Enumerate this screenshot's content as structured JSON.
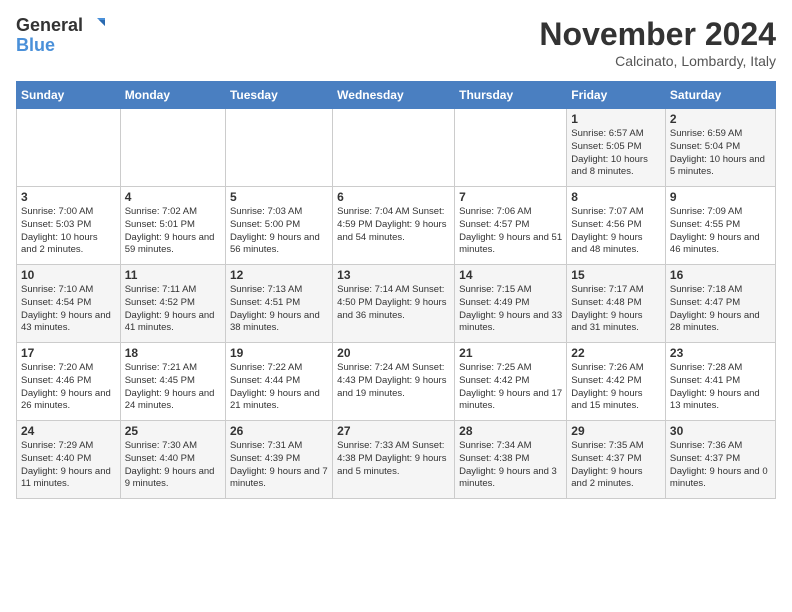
{
  "logo": {
    "line1": "General",
    "line2": "Blue"
  },
  "title": "November 2024",
  "location": "Calcinato, Lombardy, Italy",
  "weekdays": [
    "Sunday",
    "Monday",
    "Tuesday",
    "Wednesday",
    "Thursday",
    "Friday",
    "Saturday"
  ],
  "weeks": [
    [
      {
        "day": "",
        "info": ""
      },
      {
        "day": "",
        "info": ""
      },
      {
        "day": "",
        "info": ""
      },
      {
        "day": "",
        "info": ""
      },
      {
        "day": "",
        "info": ""
      },
      {
        "day": "1",
        "info": "Sunrise: 6:57 AM\nSunset: 5:05 PM\nDaylight: 10 hours\nand 8 minutes."
      },
      {
        "day": "2",
        "info": "Sunrise: 6:59 AM\nSunset: 5:04 PM\nDaylight: 10 hours\nand 5 minutes."
      }
    ],
    [
      {
        "day": "3",
        "info": "Sunrise: 7:00 AM\nSunset: 5:03 PM\nDaylight: 10 hours\nand 2 minutes."
      },
      {
        "day": "4",
        "info": "Sunrise: 7:02 AM\nSunset: 5:01 PM\nDaylight: 9 hours\nand 59 minutes."
      },
      {
        "day": "5",
        "info": "Sunrise: 7:03 AM\nSunset: 5:00 PM\nDaylight: 9 hours\nand 56 minutes."
      },
      {
        "day": "6",
        "info": "Sunrise: 7:04 AM\nSunset: 4:59 PM\nDaylight: 9 hours\nand 54 minutes."
      },
      {
        "day": "7",
        "info": "Sunrise: 7:06 AM\nSunset: 4:57 PM\nDaylight: 9 hours\nand 51 minutes."
      },
      {
        "day": "8",
        "info": "Sunrise: 7:07 AM\nSunset: 4:56 PM\nDaylight: 9 hours\nand 48 minutes."
      },
      {
        "day": "9",
        "info": "Sunrise: 7:09 AM\nSunset: 4:55 PM\nDaylight: 9 hours\nand 46 minutes."
      }
    ],
    [
      {
        "day": "10",
        "info": "Sunrise: 7:10 AM\nSunset: 4:54 PM\nDaylight: 9 hours\nand 43 minutes."
      },
      {
        "day": "11",
        "info": "Sunrise: 7:11 AM\nSunset: 4:52 PM\nDaylight: 9 hours\nand 41 minutes."
      },
      {
        "day": "12",
        "info": "Sunrise: 7:13 AM\nSunset: 4:51 PM\nDaylight: 9 hours\nand 38 minutes."
      },
      {
        "day": "13",
        "info": "Sunrise: 7:14 AM\nSunset: 4:50 PM\nDaylight: 9 hours\nand 36 minutes."
      },
      {
        "day": "14",
        "info": "Sunrise: 7:15 AM\nSunset: 4:49 PM\nDaylight: 9 hours\nand 33 minutes."
      },
      {
        "day": "15",
        "info": "Sunrise: 7:17 AM\nSunset: 4:48 PM\nDaylight: 9 hours\nand 31 minutes."
      },
      {
        "day": "16",
        "info": "Sunrise: 7:18 AM\nSunset: 4:47 PM\nDaylight: 9 hours\nand 28 minutes."
      }
    ],
    [
      {
        "day": "17",
        "info": "Sunrise: 7:20 AM\nSunset: 4:46 PM\nDaylight: 9 hours\nand 26 minutes."
      },
      {
        "day": "18",
        "info": "Sunrise: 7:21 AM\nSunset: 4:45 PM\nDaylight: 9 hours\nand 24 minutes."
      },
      {
        "day": "19",
        "info": "Sunrise: 7:22 AM\nSunset: 4:44 PM\nDaylight: 9 hours\nand 21 minutes."
      },
      {
        "day": "20",
        "info": "Sunrise: 7:24 AM\nSunset: 4:43 PM\nDaylight: 9 hours\nand 19 minutes."
      },
      {
        "day": "21",
        "info": "Sunrise: 7:25 AM\nSunset: 4:42 PM\nDaylight: 9 hours\nand 17 minutes."
      },
      {
        "day": "22",
        "info": "Sunrise: 7:26 AM\nSunset: 4:42 PM\nDaylight: 9 hours\nand 15 minutes."
      },
      {
        "day": "23",
        "info": "Sunrise: 7:28 AM\nSunset: 4:41 PM\nDaylight: 9 hours\nand 13 minutes."
      }
    ],
    [
      {
        "day": "24",
        "info": "Sunrise: 7:29 AM\nSunset: 4:40 PM\nDaylight: 9 hours\nand 11 minutes."
      },
      {
        "day": "25",
        "info": "Sunrise: 7:30 AM\nSunset: 4:40 PM\nDaylight: 9 hours\nand 9 minutes."
      },
      {
        "day": "26",
        "info": "Sunrise: 7:31 AM\nSunset: 4:39 PM\nDaylight: 9 hours\nand 7 minutes."
      },
      {
        "day": "27",
        "info": "Sunrise: 7:33 AM\nSunset: 4:38 PM\nDaylight: 9 hours\nand 5 minutes."
      },
      {
        "day": "28",
        "info": "Sunrise: 7:34 AM\nSunset: 4:38 PM\nDaylight: 9 hours\nand 3 minutes."
      },
      {
        "day": "29",
        "info": "Sunrise: 7:35 AM\nSunset: 4:37 PM\nDaylight: 9 hours\nand 2 minutes."
      },
      {
        "day": "30",
        "info": "Sunrise: 7:36 AM\nSunset: 4:37 PM\nDaylight: 9 hours\nand 0 minutes."
      }
    ]
  ]
}
